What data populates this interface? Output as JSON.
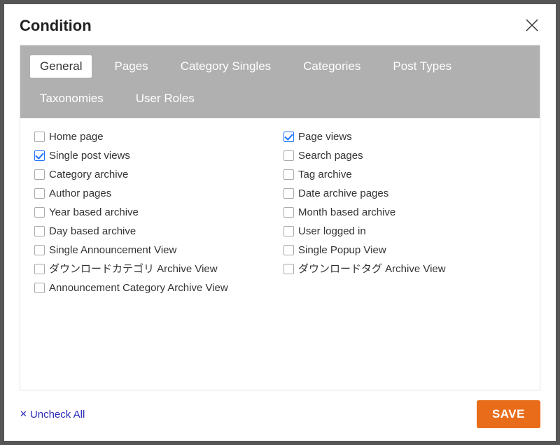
{
  "modal": {
    "title": "Condition"
  },
  "tabs": [
    {
      "label": "General",
      "active": true
    },
    {
      "label": "Pages",
      "active": false
    },
    {
      "label": "Category Singles",
      "active": false
    },
    {
      "label": "Categories",
      "active": false
    },
    {
      "label": "Post Types",
      "active": false
    },
    {
      "label": "Taxonomies",
      "active": false
    },
    {
      "label": "User Roles",
      "active": false
    }
  ],
  "checkboxes": {
    "left": [
      {
        "label": "Home page",
        "checked": false
      },
      {
        "label": "Single post views",
        "checked": true
      },
      {
        "label": "Category archive",
        "checked": false
      },
      {
        "label": "Author pages",
        "checked": false
      },
      {
        "label": "Year based archive",
        "checked": false
      },
      {
        "label": "Day based archive",
        "checked": false
      },
      {
        "label": "Single Announcement View",
        "checked": false
      },
      {
        "label": "ダウンロードカテゴリ Archive View",
        "checked": false
      },
      {
        "label": "Announcement Category Archive View",
        "checked": false
      }
    ],
    "right": [
      {
        "label": "Page views",
        "checked": true
      },
      {
        "label": "Search pages",
        "checked": false
      },
      {
        "label": "Tag archive",
        "checked": false
      },
      {
        "label": "Date archive pages",
        "checked": false
      },
      {
        "label": "Month based archive",
        "checked": false
      },
      {
        "label": "User logged in",
        "checked": false
      },
      {
        "label": "Single Popup View",
        "checked": false
      },
      {
        "label": "ダウンロードタグ Archive View",
        "checked": false
      }
    ]
  },
  "footer": {
    "uncheck_all": "Uncheck All",
    "save": "SAVE"
  }
}
